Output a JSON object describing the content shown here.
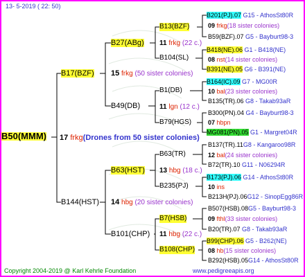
{
  "header": {
    "date": "13-  5-2019 (  22:  50)"
  },
  "footer": {
    "copyright": "Copyright 2004-2019 @ Karl Kehrle Foundation",
    "url": "www.pedigreeapis.org"
  },
  "root": {
    "name": "B50(MMM)",
    "num": "17",
    "unit": "frkg",
    "note": "(Drones from 50 sister colonies)"
  },
  "gen1": [
    {
      "name": "B17(BZF)",
      "num": "15",
      "unit": "frkg",
      "note": "(50 sister colonies)"
    },
    {
      "name": "B144(HST)",
      "num": "14",
      "unit": "hbg",
      "note": "(20 sister colonies)"
    }
  ],
  "gen2": [
    {
      "name": "B27(ABg)",
      "num": "11",
      "unit": "frkg",
      "note": "(22 c.)"
    },
    {
      "name": "B49(DB)",
      "num": "11",
      "unit": "lgn",
      "note": "(12 c.)"
    },
    {
      "name": "B63(HST)",
      "num": "13",
      "unit": "hbg",
      "note": "(18 c.)"
    },
    {
      "name": "B101(CHP)",
      "num": "11",
      "unit": "hbg",
      "note": "(22 c.)"
    }
  ],
  "gen3": [
    {
      "name": "B13(BZF)"
    },
    {
      "name": "B104(SL)"
    },
    {
      "name": "B1(DB)"
    },
    {
      "name": "B79(HGS)"
    },
    {
      "name": "B63(TR)"
    },
    {
      "name": "B235(PJ)"
    },
    {
      "name": "B7(HSB)"
    },
    {
      "name": "B108(CHP)"
    }
  ],
  "gen4": [
    {
      "a": "B201(PJ).07",
      "a_note": "G15 - AthosSt80R",
      "num": "09",
      "unit": "frkg",
      "mid": "(18 sister colonies)",
      "b": "B59(BZF).07",
      "b_note": "G5 - Bayburt98-3"
    },
    {
      "a": "B418(NE).06",
      "a_note": "G1 - B418(NE)",
      "num": "08",
      "unit": "nst",
      "mid": "(14 sister colonies)",
      "b": "B391(NE).05",
      "b_note": "G6 - B391(NE)"
    },
    {
      "a": "B164(IC).09",
      "a_note": "G7 - MG00R",
      "num": "10",
      "unit": "bal",
      "mid": "(23 sister colonies)",
      "b": "B135(TR).06",
      "b_note": "G8 - Takab93aR"
    },
    {
      "a": "B300(PN).04",
      "a_note": "G4 - Bayburt98-3",
      "num": "07",
      "unit": "hbpn",
      "mid": "",
      "b": "MG081(PN).05",
      "b_note": "G1 - Margret04R"
    },
    {
      "a": "B137(TR).11",
      "a_note": "G8 - Kangaroo98R",
      "num": "12",
      "unit": "bal",
      "mid": "(24 sister colonies)",
      "b": "B72(TR).10",
      "b_note": "G11 - N06294R"
    },
    {
      "a": "B173(PJ).06",
      "a_note": "G14 - AthosSt80R",
      "num": "10",
      "unit": "ins",
      "mid": "",
      "b": "B213H(PJ).06",
      "b_note": "G12 - SinopEgg86R"
    },
    {
      "a": "B507(HSB).08",
      "a_note": "G5 - Bayburt98-3",
      "num": "09",
      "unit": "fthl",
      "mid": "(33 sister colonies)",
      "b": "B20(TR).07",
      "b_note": "G8 - Takab93aR"
    },
    {
      "a": "B99(CHP).06",
      "a_note": "G5 - B262(NE)",
      "num": "08",
      "unit": "hb",
      "mid": "(15 sister colonies)",
      "b": "B292(HSB).05",
      "b_note": "G14 - AthosSt80R"
    }
  ],
  "colors": {
    "frame": "#ff00ff",
    "yellow": "#ffff33",
    "cyan": "#33ffff",
    "green": "#33dd33"
  }
}
